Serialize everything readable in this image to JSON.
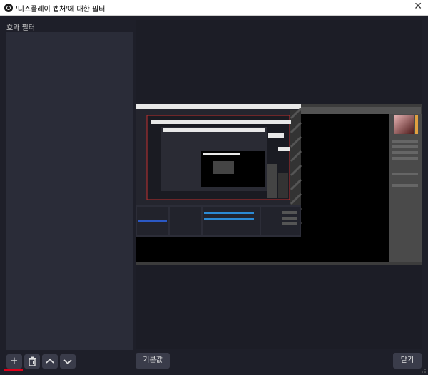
{
  "window": {
    "title": "'디스플레이 캡처'에 대한 필터",
    "close_glyph": "✕"
  },
  "filters_panel": {
    "label": "효과 필터",
    "items": []
  },
  "toolbar": {
    "add_glyph": "+",
    "remove_glyph": "🗑",
    "up_glyph": "⌃",
    "down_glyph": "⌄"
  },
  "buttons": {
    "reset_label": "기본값",
    "close_label": "닫기"
  },
  "colors": {
    "accent_underline": "#e0001a",
    "panel_bg": "#2a2c38",
    "window_bg": "#1e1f29"
  }
}
